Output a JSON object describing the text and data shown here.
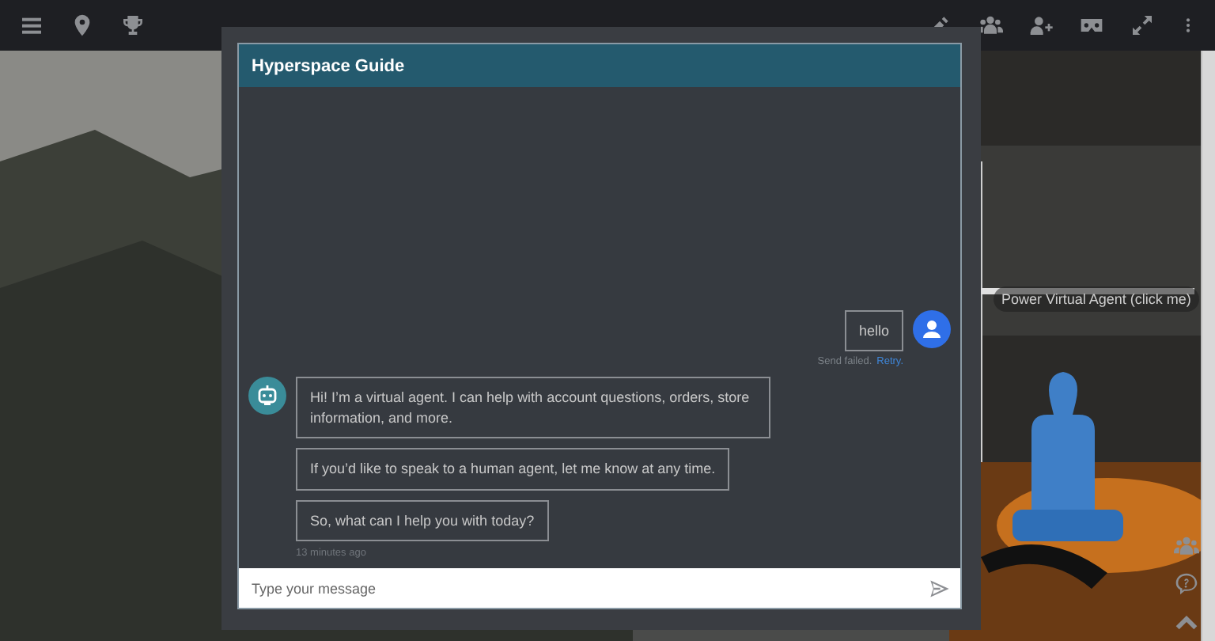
{
  "dialog": {
    "title": "Hyperspace Guide"
  },
  "scene_label": "Power Virtual Agent (click me)",
  "messages": [
    {
      "kind": "user",
      "text": "hello",
      "status": "Send failed.",
      "retry": "Retry."
    },
    {
      "kind": "bot",
      "text": "Hi! I’m a virtual agent. I can help with account questions, orders, store information, and more."
    },
    {
      "kind": "bot",
      "text": "If you’d like to speak to a human agent, let me know at any time."
    },
    {
      "kind": "bot",
      "text": "So, what can I help you with today?"
    }
  ],
  "timestamp": "13 minutes ago",
  "composer": {
    "placeholder": "Type your message"
  }
}
